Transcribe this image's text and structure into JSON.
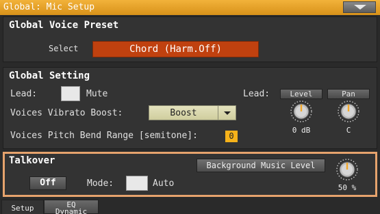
{
  "window": {
    "title": "Global: Mic Setup",
    "menu_icon": "chevron-down-icon"
  },
  "voice_preset": {
    "title": "Global Voice Preset",
    "select_label": "Select",
    "value": "Chord (Harm.Off)"
  },
  "global_setting": {
    "title": "Global Setting",
    "lead_label": "Lead:",
    "mute_label": "Mute",
    "lead_right_label": "Lead:",
    "level_header": "Level",
    "pan_header": "Pan",
    "level_value": "0 dB",
    "pan_value": "C",
    "vibrato_label": "Voices Vibrato Boost:",
    "vibrato_value": "Boost",
    "pitch_bend_label": "Voices Pitch Bend Range [semitone]:",
    "pitch_bend_value": "0"
  },
  "talkover": {
    "title": "Talkover",
    "off_label": "Off",
    "mode_label": "Mode:",
    "auto_label": "Auto",
    "bg_music_label": "Background Music Level",
    "bg_music_value": "50 %"
  },
  "tabs": [
    {
      "label": "Setup",
      "active": true
    },
    {
      "label_line1": "EQ",
      "label_line2": "Dynamic",
      "active": false
    }
  ],
  "colors": {
    "accent": "#f2a82a",
    "field": "#c0410f",
    "talkover_border": "#e6a36d"
  }
}
